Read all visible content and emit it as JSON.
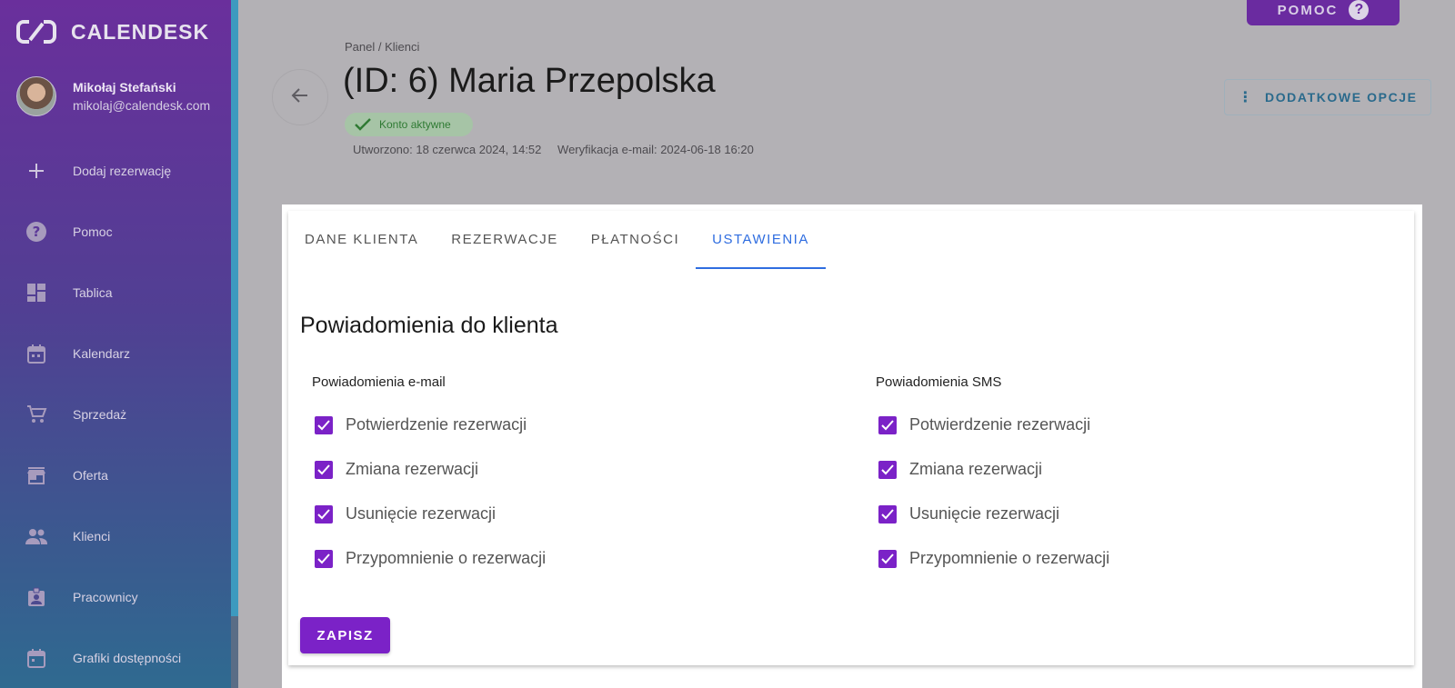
{
  "app": {
    "logo_text": "CALENDESK",
    "help_label": "POMOC"
  },
  "user": {
    "name": "Mikołaj Stefański",
    "email": "mikolaj@calendesk.com"
  },
  "sidebar": {
    "items": [
      {
        "label": "Dodaj rezerwację",
        "icon": "plus-icon"
      },
      {
        "label": "Pomoc",
        "icon": "help-circle-icon"
      },
      {
        "label": "Tablica",
        "icon": "dashboard-icon"
      },
      {
        "label": "Kalendarz",
        "icon": "calendar-icon"
      },
      {
        "label": "Sprzedaż",
        "icon": "cart-icon"
      },
      {
        "label": "Oferta",
        "icon": "store-icon"
      },
      {
        "label": "Klienci",
        "icon": "people-icon"
      },
      {
        "label": "Pracownicy",
        "icon": "badge-icon"
      },
      {
        "label": "Grafiki dostępności",
        "icon": "calendar-clock-icon"
      }
    ]
  },
  "header": {
    "breadcrumb": "Panel / Klienci",
    "title": "(ID: 6) Maria Przepolska",
    "status": "Konto aktywne",
    "created": "Utworzono: 18 czerwca 2024, 14:52",
    "verification": "Weryfikacja e-mail: 2024-06-18 16:20",
    "options_label": "DODATKOWE OPCJE"
  },
  "tabs": [
    {
      "label": "DANE KLIENTA",
      "active": false
    },
    {
      "label": "REZERWACJE",
      "active": false
    },
    {
      "label": "PŁATNOŚCI",
      "active": false
    },
    {
      "label": "USTAWIENIA",
      "active": true
    }
  ],
  "settings": {
    "section_title": "Powiadomienia do klienta",
    "email": {
      "title": "Powiadomienia e-mail",
      "options": [
        {
          "label": "Potwierdzenie rezerwacji",
          "checked": true
        },
        {
          "label": "Zmiana rezerwacji",
          "checked": true
        },
        {
          "label": "Usunięcie rezerwacji",
          "checked": true
        },
        {
          "label": "Przypomnienie o rezerwacji",
          "checked": true
        }
      ]
    },
    "sms": {
      "title": "Powiadomienia SMS",
      "options": [
        {
          "label": "Potwierdzenie rezerwacji",
          "checked": true
        },
        {
          "label": "Zmiana rezerwacji",
          "checked": true
        },
        {
          "label": "Usunięcie rezerwacji",
          "checked": true
        },
        {
          "label": "Przypomnienie o rezerwacji",
          "checked": true
        }
      ]
    },
    "save_label": "ZAPISZ"
  },
  "colors": {
    "accent": "#7b22c7",
    "tab_active": "#2f6de0",
    "status_green": "#2f7a33"
  }
}
